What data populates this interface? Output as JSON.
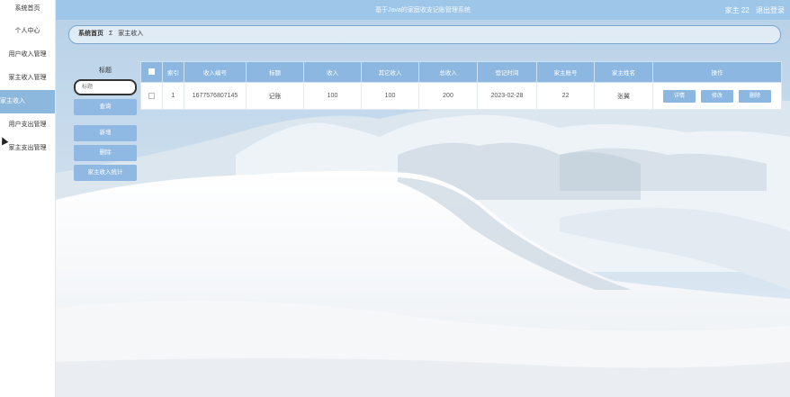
{
  "app": {
    "title": "基于Java的家庭收支记账管理系统",
    "user_label": "家主 22",
    "logout_label": "退出登录"
  },
  "sidebar": {
    "items": [
      {
        "label": "系统首页"
      },
      {
        "label": "个人中心"
      },
      {
        "label": "用户收入管理"
      },
      {
        "label": "家主收入管理"
      },
      {
        "label": "家主收入",
        "active": true
      },
      {
        "label": "用户支出管理"
      },
      {
        "label": "家主支出管理"
      }
    ]
  },
  "breadcrumb": {
    "home": "系统首页",
    "separator": "Σ",
    "current": "家主收入"
  },
  "search": {
    "label": "标题",
    "placeholder": "标题",
    "query_label": "查询"
  },
  "actions": {
    "add_label": "新增",
    "delete_label": "删除",
    "stats_label": "家主收入统计"
  },
  "table": {
    "headers": [
      "索引",
      "收入编号",
      "标题",
      "收入",
      "其它收入",
      "总收入",
      "登记时间",
      "家主账号",
      "家主姓名",
      "操作"
    ],
    "rows": [
      {
        "index": "1",
        "income_no": "1677576807145",
        "title": "记账",
        "income": "100",
        "other_income": "100",
        "total_income": "200",
        "register_time": "2023-02-28",
        "owner_account": "22",
        "owner_name": "张翼",
        "ops": {
          "detail": "详情",
          "edit": "修改",
          "delete": "删除"
        }
      }
    ]
  },
  "colors": {
    "accent": "#8bb7e1",
    "header_bg": "#9ec6e8",
    "active_nav": "#8db8dd"
  }
}
